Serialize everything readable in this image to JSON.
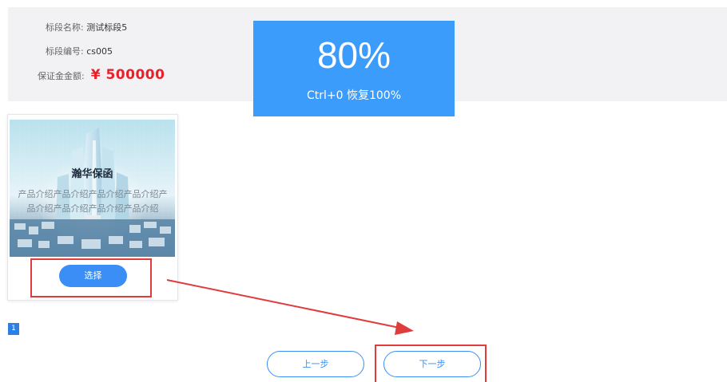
{
  "bid_info": {
    "section_name_label": "标段名称:",
    "section_name_value": "测试标段5",
    "section_code_label": "标段编号:",
    "section_code_value": "cs005",
    "deposit_label": "保证金金额:",
    "deposit_value": "¥ 500000"
  },
  "zoom_overlay": {
    "value": "80%",
    "hint": "Ctrl+0 恢复100%"
  },
  "product_card": {
    "title": "瀚华保函",
    "description": "产品介绍产品介绍产品介绍产品介绍产品介绍产品介绍产品介绍产品介绍",
    "select_label": "选择"
  },
  "pagination": {
    "current_page": "1"
  },
  "navigation": {
    "prev_label": "上一步",
    "next_label": "下一步"
  },
  "colors": {
    "accent": "#3a8ef6",
    "deposit_red": "#e8202a",
    "annotation_red": "#e13c3c",
    "overlay_blue": "#3b9cfc"
  }
}
